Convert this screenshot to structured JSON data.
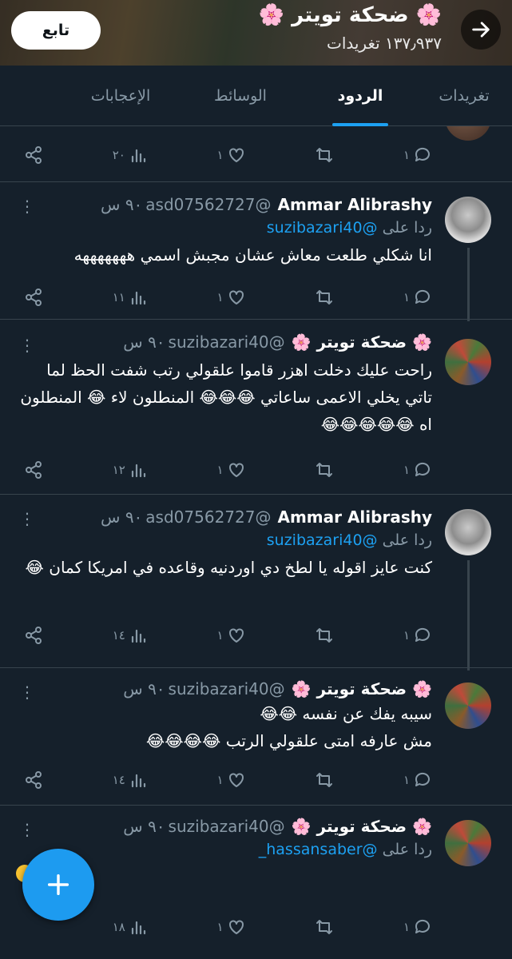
{
  "header": {
    "title": "🌸 ضحكة تويتر 🌸",
    "subtitle": "١٣٧٫٩٣٧ تغريدات",
    "follow_label": "تابع"
  },
  "tabs": [
    {
      "label": "تغريدات",
      "active": false
    },
    {
      "label": "الردود",
      "active": true
    },
    {
      "label": "الوسائط",
      "active": false
    },
    {
      "label": "الإعجابات",
      "active": false
    }
  ],
  "partial_tweet": {
    "reply_count": "١",
    "retweet_count": "",
    "like_count": "١",
    "view_count": "٢٠"
  },
  "tweets": [
    {
      "name": "Ammar Alibrashy",
      "handle": "@asd07562727",
      "time": "٩٠ س",
      "reply_to_prefix": "ردا على",
      "reply_to_handle": "@suzibazari40",
      "text": "انا شكلي طلعت معاش عشان مجبش اسمي هههههههه",
      "reply_count": "١",
      "like_count": "١",
      "view_count": "١١"
    },
    {
      "name": "🌸 ضحكة تويتر 🌸",
      "handle": "@suzibazari40",
      "time": "٩٠ س",
      "text": "راحت عليك دخلت اهزر قاموا علقولي رتب شفت الحظ لما تاتي يخلي الاعمى ساعاتي 😂😂😂 المنطلون لاء 😂 المنطلون اه 😂😂😂😂😂",
      "reply_count": "١",
      "like_count": "١",
      "view_count": "١٢"
    },
    {
      "name": "Ammar Alibrashy",
      "handle": "@asd07562727",
      "time": "٩٠ س",
      "reply_to_prefix": "ردا على",
      "reply_to_handle": "@suzibazari40",
      "text": "كنت عايز اقوله يا لطخ دي اوردنيه وقاعده في امريكا كمان 😂",
      "reply_count": "١",
      "like_count": "١",
      "view_count": "١٤"
    },
    {
      "name": "🌸 ضحكة تويتر 🌸",
      "handle": "@suzibazari40",
      "time": "٩٠ س",
      "text_line1": "سيبه يفك عن نفسه 😂😂",
      "text_line2": "مش عارفه امتى علقولي الرتب 😂😂😂😂",
      "reply_count": "١",
      "like_count": "١",
      "view_count": "١٤"
    },
    {
      "name": "🌸 ضحكة تويتر 🌸",
      "handle": "@suzibazari40",
      "time": "٩٠ س",
      "reply_to_prefix": "ردا على",
      "reply_to_handle": "@hassansaber_",
      "reply_count": "١",
      "like_count": "١",
      "view_count": "١٨"
    }
  ],
  "icons": {
    "back": "arrow-right-icon",
    "reply": "reply-icon",
    "retweet": "retweet-icon",
    "like": "heart-icon",
    "views": "views-icon",
    "share": "share-icon",
    "more": "more-vertical-icon",
    "compose": "plus-icon"
  },
  "colors": {
    "background": "#15202b",
    "divider": "#38444d",
    "secondary_text": "#8899a6",
    "accent": "#1da1f2"
  }
}
